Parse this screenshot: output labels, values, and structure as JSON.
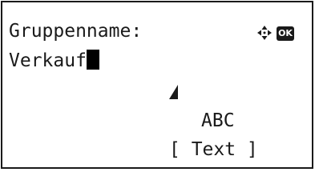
{
  "screen": {
    "title": "Gruppenname:",
    "input_value": "Verkauf",
    "ok_label": "OK",
    "input_mode": "ABC",
    "softkey_label": "[ Text ]"
  },
  "icons": {
    "navigation": "four-way-arrow-icon",
    "ok": "ok-key-icon",
    "shift": "shift-triangle-icon",
    "cursor": "text-cursor-block"
  }
}
